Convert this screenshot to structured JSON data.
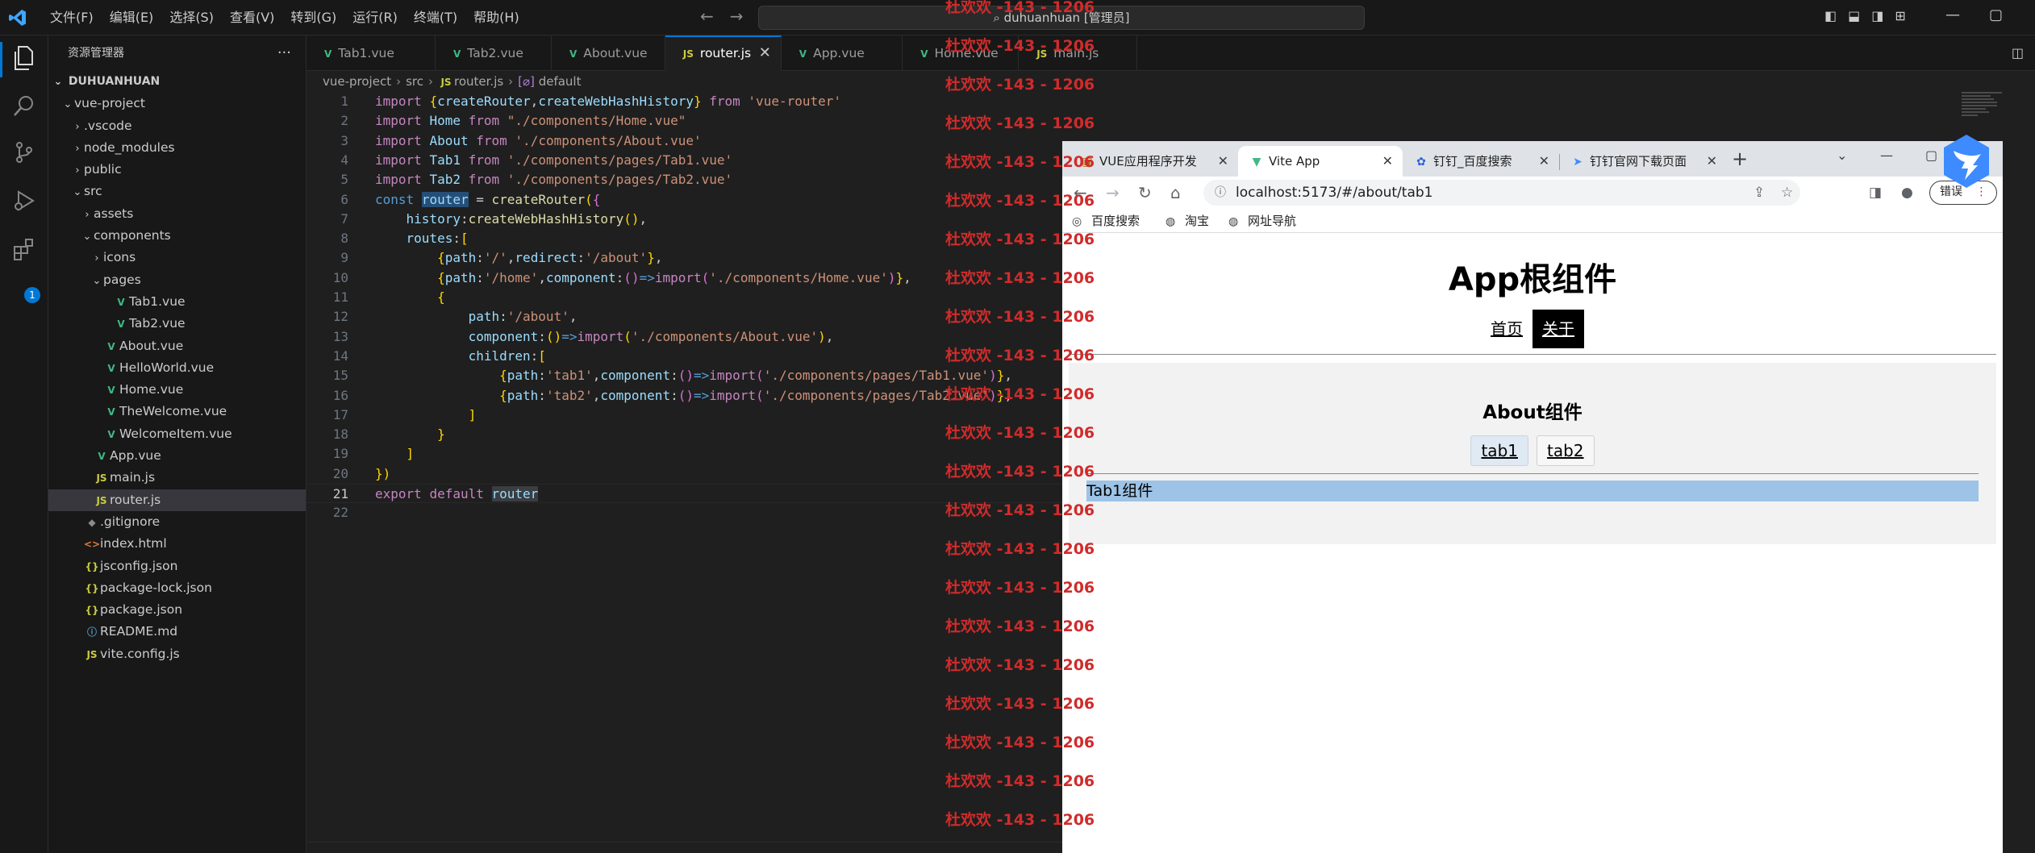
{
  "titlebar": {
    "menu": [
      "文件(F)",
      "编辑(E)",
      "选择(S)",
      "查看(V)",
      "转到(G)",
      "运行(R)",
      "终端(T)",
      "帮助(H)"
    ],
    "search_text": "duhuanhuan [管理员]"
  },
  "sidebar": {
    "header": "资源管理器",
    "more": "···",
    "root": "DUHUANHUAN",
    "items": [
      {
        "label": "vue-project",
        "indent": 1,
        "chev": "⌄",
        "icon": "",
        "type": "folder"
      },
      {
        "label": ".vscode",
        "indent": 2,
        "chev": "›",
        "icon": "",
        "type": "folder"
      },
      {
        "label": "node_modules",
        "indent": 2,
        "chev": "›",
        "icon": "",
        "type": "folder"
      },
      {
        "label": "public",
        "indent": 2,
        "chev": "›",
        "icon": "",
        "type": "folder"
      },
      {
        "label": "src",
        "indent": 2,
        "chev": "⌄",
        "icon": "",
        "type": "folder"
      },
      {
        "label": "assets",
        "indent": 3,
        "chev": "›",
        "icon": "",
        "type": "folder"
      },
      {
        "label": "components",
        "indent": 3,
        "chev": "⌄",
        "icon": "",
        "type": "folder"
      },
      {
        "label": "icons",
        "indent": 4,
        "chev": "›",
        "icon": "",
        "type": "folder"
      },
      {
        "label": "pages",
        "indent": 4,
        "chev": "⌄",
        "icon": "",
        "type": "folder"
      },
      {
        "label": "Tab1.vue",
        "indent": 5,
        "chev": "",
        "icon": "V",
        "type": "vue"
      },
      {
        "label": "Tab2.vue",
        "indent": 5,
        "chev": "",
        "icon": "V",
        "type": "vue"
      },
      {
        "label": "About.vue",
        "indent": 4,
        "chev": "",
        "icon": "V",
        "type": "vue"
      },
      {
        "label": "HelloWorld.vue",
        "indent": 4,
        "chev": "",
        "icon": "V",
        "type": "vue"
      },
      {
        "label": "Home.vue",
        "indent": 4,
        "chev": "",
        "icon": "V",
        "type": "vue"
      },
      {
        "label": "TheWelcome.vue",
        "indent": 4,
        "chev": "",
        "icon": "V",
        "type": "vue"
      },
      {
        "label": "WelcomeItem.vue",
        "indent": 4,
        "chev": "",
        "icon": "V",
        "type": "vue"
      },
      {
        "label": "App.vue",
        "indent": 3,
        "chev": "",
        "icon": "V",
        "type": "vue"
      },
      {
        "label": "main.js",
        "indent": 3,
        "chev": "",
        "icon": "JS",
        "type": "js"
      },
      {
        "label": "router.js",
        "indent": 3,
        "chev": "",
        "icon": "JS",
        "type": "js",
        "selected": true
      },
      {
        "label": ".gitignore",
        "indent": 2,
        "chev": "",
        "icon": "◆",
        "type": "git"
      },
      {
        "label": "index.html",
        "indent": 2,
        "chev": "",
        "icon": "<>",
        "type": "html"
      },
      {
        "label": "jsconfig.json",
        "indent": 2,
        "chev": "",
        "icon": "{}",
        "type": "json"
      },
      {
        "label": "package-lock.json",
        "indent": 2,
        "chev": "",
        "icon": "{}",
        "type": "json"
      },
      {
        "label": "package.json",
        "indent": 2,
        "chev": "",
        "icon": "{}",
        "type": "json"
      },
      {
        "label": "README.md",
        "indent": 2,
        "chev": "",
        "icon": "ⓘ",
        "type": "info"
      },
      {
        "label": "vite.config.js",
        "indent": 2,
        "chev": "",
        "icon": "JS",
        "type": "js"
      }
    ]
  },
  "activity": {
    "badge": "1"
  },
  "editor_tabs": [
    {
      "label": "Tab1.vue",
      "icon": "V",
      "type": "vue"
    },
    {
      "label": "Tab2.vue",
      "icon": "V",
      "type": "vue"
    },
    {
      "label": "About.vue",
      "icon": "V",
      "type": "vue"
    },
    {
      "label": "router.js",
      "icon": "JS",
      "type": "js",
      "active": true
    },
    {
      "label": "App.vue",
      "icon": "V",
      "type": "vue"
    },
    {
      "label": "Home.vue",
      "icon": "V",
      "type": "vue"
    },
    {
      "label": "main.js",
      "icon": "JS",
      "type": "js"
    }
  ],
  "breadcrumb": {
    "parts": [
      "vue-project",
      "src",
      "router.js",
      "default"
    ]
  },
  "code": {
    "current_line": 21,
    "lines": [
      "import {createRouter,createWebHashHistory} from 'vue-router'",
      "import Home from \"./components/Home.vue\"",
      "import About from './components/About.vue'",
      "import Tab1 from './components/pages/Tab1.vue'",
      "import Tab2 from './components/pages/Tab2.vue'",
      "const router = createRouter({",
      "    history:createWebHashHistory(),",
      "    routes:[",
      "        {path:'/',redirect:'/about'},",
      "        {path:'/home',component:()=>import('./components/Home.vue')},",
      "        {",
      "            path:'/about',",
      "            component:()=>import('./components/About.vue'),",
      "            children:[",
      "                {path:'tab1',component:()=>import('./components/pages/Tab1.vue')},",
      "                {path:'tab2',component:()=>import('./components/pages/Tab2.vue')},",
      "            ]",
      "        }",
      "    ]",
      "})",
      "export default router",
      ""
    ]
  },
  "watermark": {
    "text": "杜欢欢 -143 - 1206",
    "count": 22
  },
  "browser": {
    "tabs": [
      {
        "label": "VUE应用程序开发",
        "favicon": "▣"
      },
      {
        "label": "Vite App",
        "favicon": "▼",
        "active": true
      },
      {
        "label": "钉钉_百度搜索",
        "favicon": "✿"
      },
      {
        "label": "钉钉官网下载页面",
        "favicon": "➤"
      }
    ],
    "url": "localhost:5173/#/about/tab1",
    "error_label": "错误",
    "bookmarks": [
      "百度搜索",
      "淘宝",
      "网址导航"
    ],
    "page": {
      "title": "App根组件",
      "nav": [
        {
          "label": "首页"
        },
        {
          "label": "关于",
          "active": true
        }
      ],
      "about_title": "About组件",
      "subnav": [
        {
          "label": "tab1",
          "active": true
        },
        {
          "label": "tab2"
        }
      ],
      "tab_content": "Tab1组件"
    }
  },
  "colors": {
    "accent": "#0078d4",
    "watermark": "#d12b2b",
    "vue": "#41b883",
    "js": "#cbcb41"
  }
}
